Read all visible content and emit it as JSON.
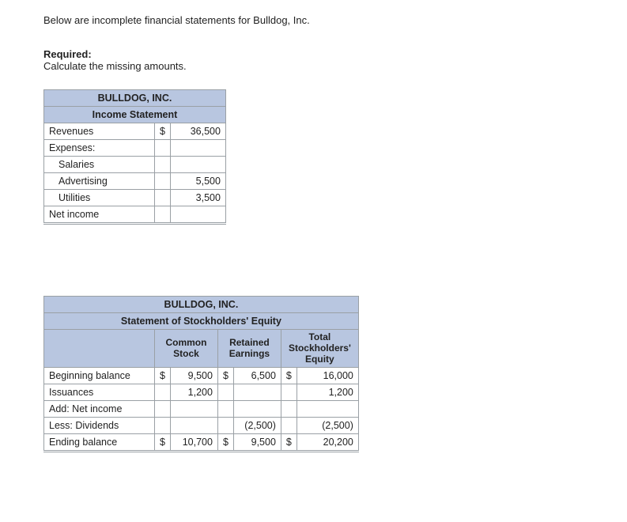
{
  "intro": "Below are incomplete financial statements for Bulldog, Inc.",
  "required_label": "Required:",
  "required_text": "Calculate the missing amounts.",
  "t1": {
    "company": "BULLDOG, INC.",
    "title": "Income Statement",
    "rows": {
      "revenues": "Revenues",
      "revenues_cur": "$",
      "revenues_val": "36,500",
      "expenses": "Expenses:",
      "salaries": "Salaries",
      "advertising": "Advertising",
      "advertising_val": "5,500",
      "utilities": "Utilities",
      "utilities_val": "3,500",
      "net_income": "Net income"
    }
  },
  "t2": {
    "company": "BULLDOG, INC.",
    "title": "Statement of Stockholders' Equity",
    "cols": {
      "common": "Common Stock",
      "retained": "Retained Earnings",
      "total": "Total Stockholders' Equity"
    },
    "rows": {
      "beg": "Beginning balance",
      "beg_cur": "$",
      "beg_cs": "9,500",
      "beg_re": "6,500",
      "beg_tot": "16,000",
      "iss": "Issuances",
      "iss_cs": "1,200",
      "iss_tot": "1,200",
      "add_ni": "Add: Net income",
      "div": "Less: Dividends",
      "div_re": "(2,500)",
      "div_tot": "(2,500)",
      "end": "Ending balance",
      "end_cur": "$",
      "end_cs": "10,700",
      "end_re": "9,500",
      "end_tot": "20,200"
    }
  }
}
